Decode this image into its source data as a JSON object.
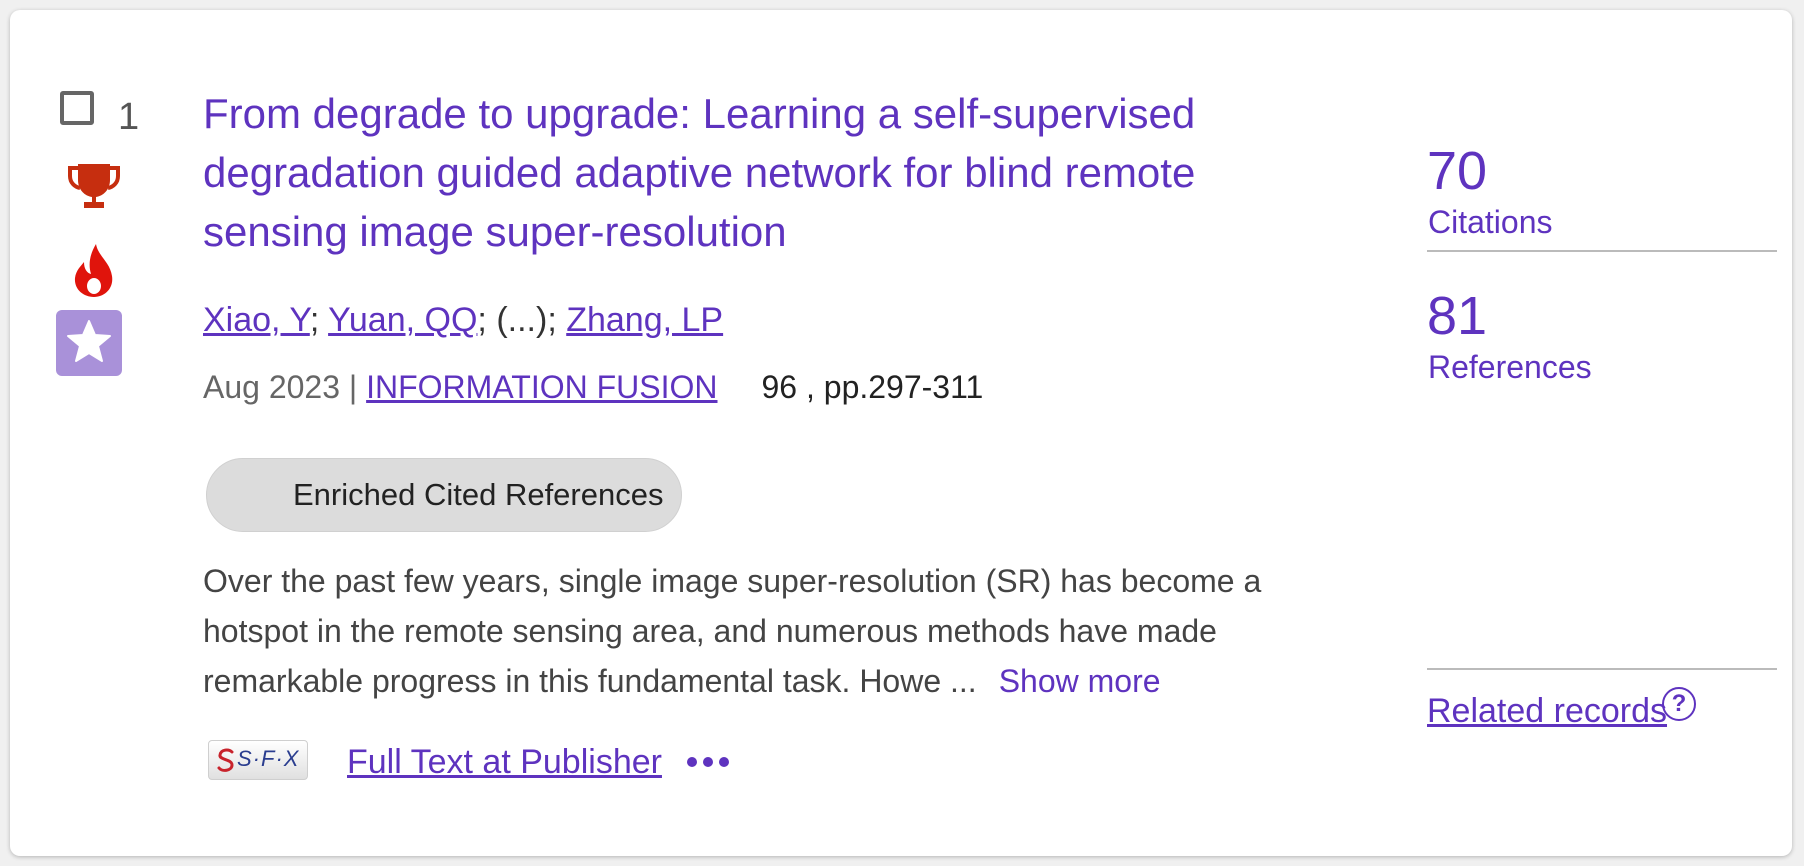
{
  "record": {
    "number": "1",
    "title": "From degrade to upgrade: Learning a self-supervised degradation guided adaptive network for blind remote sensing image super-resolution",
    "authors": [
      {
        "name": "Xiao, Y"
      },
      {
        "name": "Yuan, QQ"
      },
      {
        "name": "(...)"
      },
      {
        "name": "Zhang, LP"
      }
    ],
    "author_separator": "; ",
    "date": "Aug 2023",
    "date_separator": " | ",
    "journal": "INFORMATION FUSION",
    "volume_pages": "96 , pp.297-311",
    "enriched_label": "Enriched Cited References",
    "abstract": "Over the past few years, single image super-resolution (SR) has become a hotspot in the remote sensing area, and numerous methods have made remarkable progress in this fundamental task. Howe ...",
    "show_more_label": "Show more",
    "sfx_label": "S·F·X",
    "full_text_label": "Full Text at Publisher",
    "more_icon": "more-horizontal-icon"
  },
  "stats": {
    "citations_count": "70",
    "citations_label": "Citations",
    "references_count": "81",
    "references_label": "References"
  },
  "related": {
    "label": "Related records",
    "help_glyph": "?"
  },
  "icons": {
    "checkbox": "checkbox-icon",
    "trophy": "trophy-icon",
    "hot": "flame-icon",
    "star": "star-icon"
  },
  "colors": {
    "accent": "#5e33bf",
    "award": "#c62e0f",
    "star_box": "#a991d9"
  }
}
